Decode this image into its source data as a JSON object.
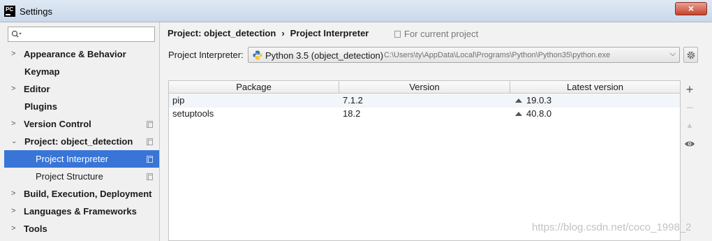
{
  "window": {
    "title": "Settings",
    "app_icon_label": "PC",
    "close_label": "×"
  },
  "sidebar": {
    "search": {
      "placeholder": "",
      "value": ""
    },
    "items": [
      {
        "label": "Appearance & Behavior",
        "expandable": true,
        "expanded": false
      },
      {
        "label": "Keymap",
        "expandable": false
      },
      {
        "label": "Editor",
        "expandable": true,
        "expanded": false
      },
      {
        "label": "Plugins",
        "expandable": false
      },
      {
        "label": "Version Control",
        "expandable": true,
        "expanded": false,
        "project_scoped": true
      },
      {
        "label": "Project: object_detection",
        "expandable": true,
        "expanded": true,
        "project_scoped": true
      },
      {
        "label": "Project Interpreter",
        "child": true,
        "selected": true,
        "project_scoped": true
      },
      {
        "label": "Project Structure",
        "child": true,
        "project_scoped": true
      },
      {
        "label": "Build, Execution, Deployment",
        "expandable": true,
        "expanded": false
      },
      {
        "label": "Languages & Frameworks",
        "expandable": true,
        "expanded": false
      },
      {
        "label": "Tools",
        "expandable": true,
        "expanded": false
      }
    ],
    "selected_color": "#3875d7"
  },
  "main": {
    "breadcrumb": {
      "parent": "Project: object_detection",
      "separator": "›",
      "current": "Project Interpreter"
    },
    "for_current_project": "For current project",
    "interpreter": {
      "label": "Project Interpreter:",
      "name": "Python 3.5 (object_detection)",
      "path": "C:\\Users\\ty\\AppData\\Local\\Programs\\Python\\Python35\\python.exe",
      "icon": "python-icon"
    },
    "table": {
      "columns": [
        "Package",
        "Version",
        "Latest version"
      ],
      "rows": [
        {
          "package": "pip",
          "version": "7.1.2",
          "latest": "19.0.3",
          "upgrade": true
        },
        {
          "package": "setuptools",
          "version": "18.2",
          "latest": "40.8.0",
          "upgrade": true
        }
      ]
    },
    "tools": {
      "add": "+",
      "remove": "−",
      "upgrade": "▲",
      "show": "eye-icon"
    }
  },
  "watermark": "https://blog.csdn.net/coco_1998_2"
}
